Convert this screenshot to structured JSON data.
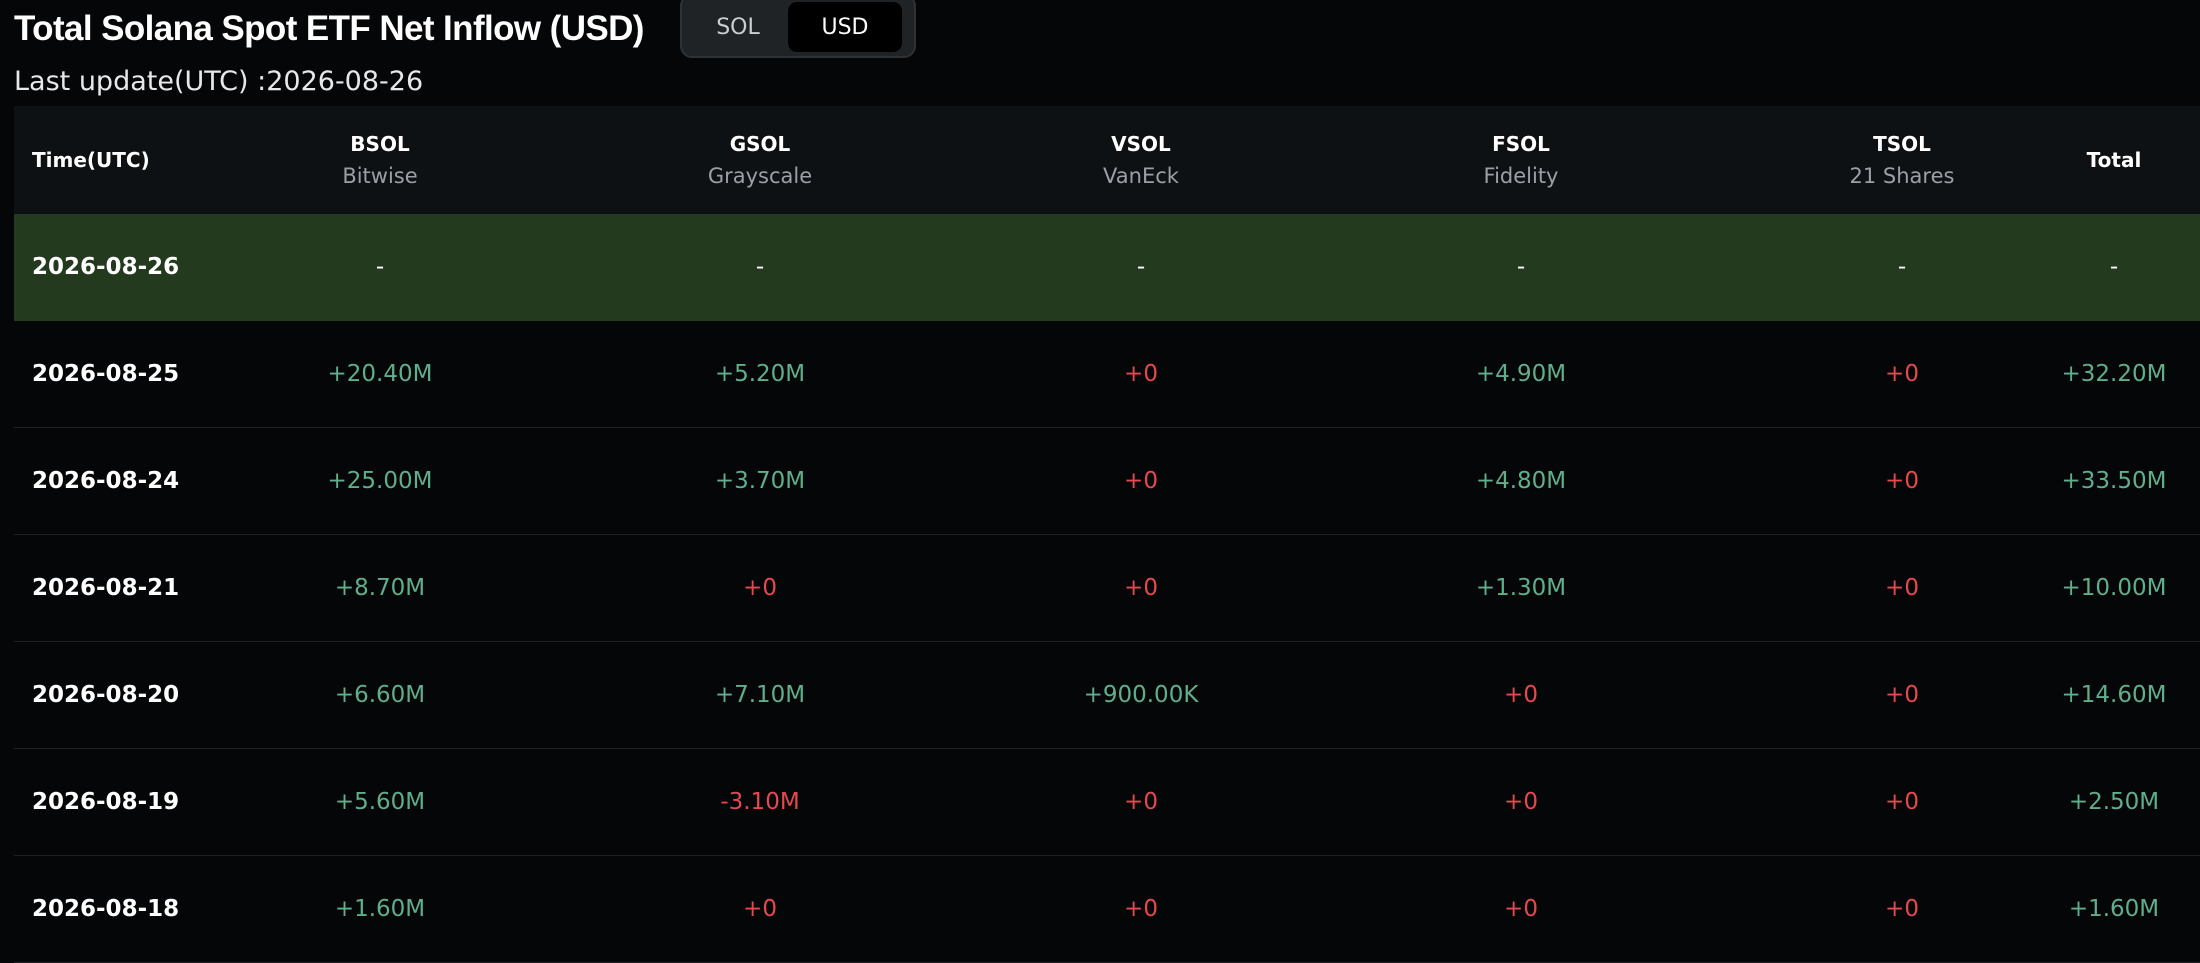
{
  "header": {
    "title": "Total Solana Spot ETF Net Inflow (USD)",
    "toggle": {
      "options": [
        "SOL",
        "USD"
      ],
      "selected": "USD"
    },
    "last_update": "Last update(UTC) :2026-08-26"
  },
  "table": {
    "columns": [
      {
        "symbol": "Time(UTC)",
        "issuer": ""
      },
      {
        "symbol": "BSOL",
        "issuer": "Bitwise"
      },
      {
        "symbol": "GSOL",
        "issuer": "Grayscale"
      },
      {
        "symbol": "VSOL",
        "issuer": "VanEck"
      },
      {
        "symbol": "FSOL",
        "issuer": "Fidelity"
      },
      {
        "symbol": "TSOL",
        "issuer": "21 Shares"
      },
      {
        "symbol": "Total",
        "issuer": ""
      }
    ],
    "rows": [
      {
        "date": "2026-08-26",
        "cells": [
          "-",
          "-",
          "-",
          "-",
          "-",
          "-"
        ]
      },
      {
        "date": "2026-08-25",
        "cells": [
          "+20.40M",
          "+5.20M",
          "+0",
          "+4.90M",
          "+0",
          "+32.20M"
        ]
      },
      {
        "date": "2026-08-24",
        "cells": [
          "+25.00M",
          "+3.70M",
          "+0",
          "+4.80M",
          "+0",
          "+33.50M"
        ]
      },
      {
        "date": "2026-08-21",
        "cells": [
          "+8.70M",
          "+0",
          "+0",
          "+1.30M",
          "+0",
          "+10.00M"
        ]
      },
      {
        "date": "2026-08-20",
        "cells": [
          "+6.60M",
          "+7.10M",
          "+900.00K",
          "+0",
          "+0",
          "+14.60M"
        ]
      },
      {
        "date": "2026-08-19",
        "cells": [
          "+5.60M",
          "-3.10M",
          "+0",
          "+0",
          "+0",
          "+2.50M"
        ]
      },
      {
        "date": "2026-08-18",
        "cells": [
          "+1.60M",
          "+0",
          "+0",
          "+0",
          "+0",
          "+1.60M"
        ]
      }
    ]
  },
  "colors": {
    "positive": "#5fae8c",
    "negative_or_zero": "#e5484d",
    "highlight_row": "#233a1f"
  }
}
